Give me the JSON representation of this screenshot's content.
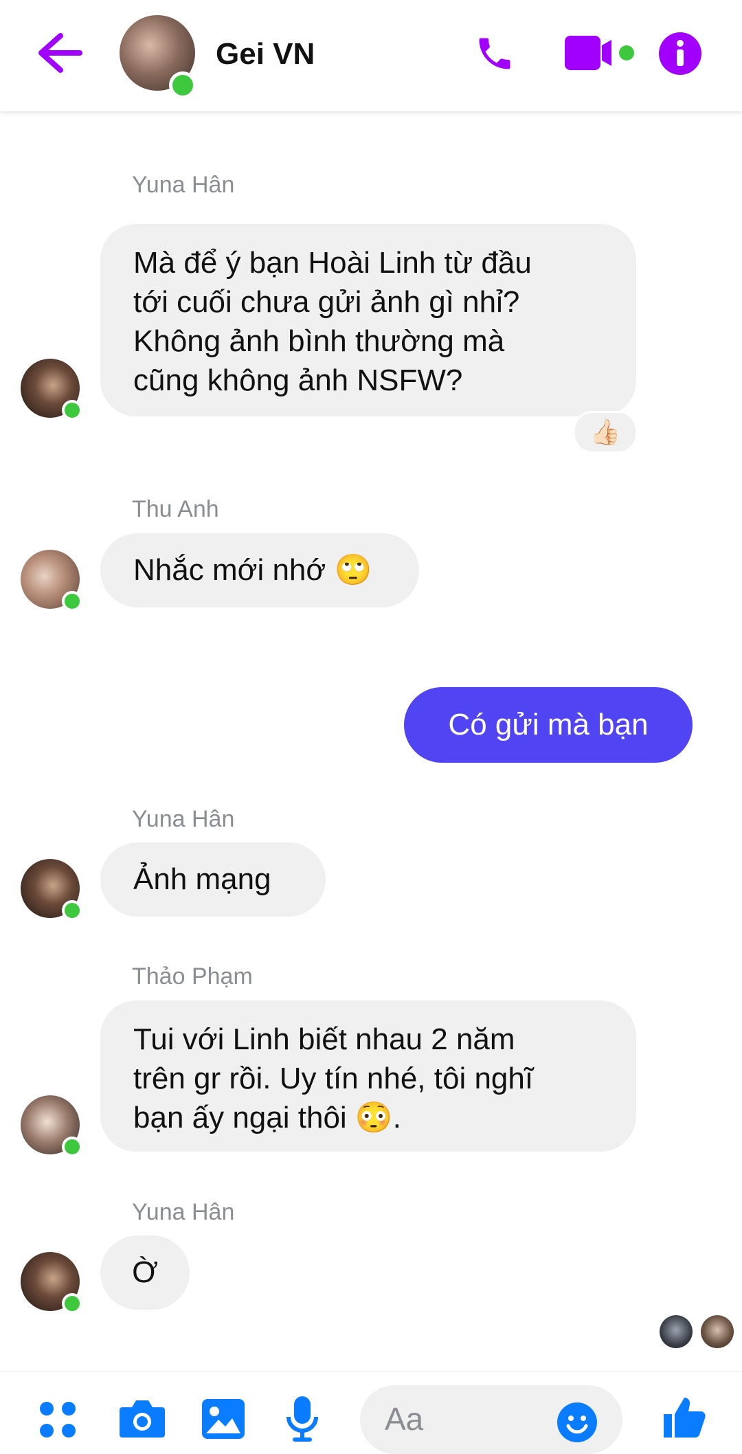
{
  "header": {
    "title": "Gei VN"
  },
  "messages": [
    {
      "sender": "Yuna Hân",
      "lines": [
        "Mà để ý bạn Hoài Linh từ đầu",
        "tới cuối chưa gửi ảnh gì nhỉ?",
        "Không ảnh bình thường mà",
        "cũng không ảnh NSFW?"
      ],
      "reaction": "👍🏻"
    },
    {
      "sender": "Thu Anh",
      "lines": [
        "Nhắc mới nhớ 🙄"
      ]
    },
    {
      "sender": "",
      "lines": [
        "Có gửi mà bạn"
      ],
      "outgoing": true
    },
    {
      "sender": "Yuna Hân",
      "lines": [
        "Ảnh mạng"
      ]
    },
    {
      "sender": "Thảo Phạm",
      "lines": [
        "Tui với Linh biết nhau 2 năm",
        "trên gr rồi. Uy tín nhé, tôi nghĩ",
        "bạn ấy ngại thôi 😳."
      ]
    },
    {
      "sender": "Yuna Hân",
      "lines": [
        "Ờ"
      ]
    }
  ],
  "composer": {
    "placeholder": "Aa"
  },
  "colors": {
    "accent": "#a100ff",
    "outgoing_bubble": "#5144f2",
    "incoming_bubble": "#f0f0f0",
    "online": "#3ec83e",
    "icon_blue": "#0a7cff"
  },
  "icons": [
    "back-arrow-icon",
    "phone-icon",
    "video-camera-icon",
    "info-icon",
    "apps-grid-icon",
    "camera-icon",
    "image-icon",
    "microphone-icon",
    "emoji-icon",
    "thumbs-up-icon"
  ]
}
